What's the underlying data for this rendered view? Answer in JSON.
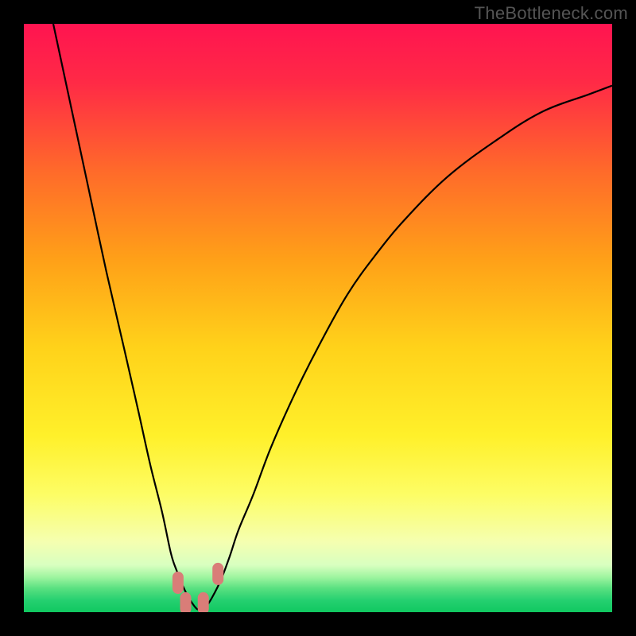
{
  "watermark": "TheBottleneck.com",
  "chart_data": {
    "type": "line",
    "title": "",
    "xlabel": "",
    "ylabel": "",
    "xlim": [
      0,
      1
    ],
    "ylim": [
      0,
      1
    ],
    "grid": false,
    "legend": false,
    "background_gradient_stops": [
      {
        "pos": 0.0,
        "color": "#ff1450"
      },
      {
        "pos": 0.1,
        "color": "#ff2a46"
      },
      {
        "pos": 0.25,
        "color": "#ff6a2a"
      },
      {
        "pos": 0.4,
        "color": "#ffa018"
      },
      {
        "pos": 0.55,
        "color": "#ffd21a"
      },
      {
        "pos": 0.7,
        "color": "#fff02a"
      },
      {
        "pos": 0.8,
        "color": "#fdfd65"
      },
      {
        "pos": 0.88,
        "color": "#f5ffb0"
      },
      {
        "pos": 0.92,
        "color": "#d8ffc0"
      },
      {
        "pos": 0.94,
        "color": "#a0f5a0"
      },
      {
        "pos": 0.96,
        "color": "#58e080"
      },
      {
        "pos": 0.98,
        "color": "#25d070"
      },
      {
        "pos": 1.0,
        "color": "#10c860"
      }
    ],
    "series": [
      {
        "name": "bottleneck-curve",
        "x": [
          0.05,
          0.08,
          0.11,
          0.14,
          0.17,
          0.195,
          0.215,
          0.235,
          0.25,
          0.26,
          0.27,
          0.28,
          0.29,
          0.295,
          0.3,
          0.31,
          0.32,
          0.335,
          0.35,
          0.365,
          0.39,
          0.42,
          0.46,
          0.5,
          0.55,
          0.6,
          0.65,
          0.72,
          0.8,
          0.88,
          0.96,
          1.0
        ],
        "y": [
          1.0,
          0.86,
          0.72,
          0.58,
          0.45,
          0.34,
          0.25,
          0.17,
          0.1,
          0.07,
          0.045,
          0.025,
          0.01,
          0.005,
          0.005,
          0.01,
          0.025,
          0.055,
          0.095,
          0.14,
          0.2,
          0.28,
          0.37,
          0.45,
          0.54,
          0.61,
          0.67,
          0.74,
          0.8,
          0.85,
          0.88,
          0.895
        ]
      }
    ],
    "markers": [
      {
        "name": "left-descent",
        "x": 0.262,
        "y": 0.05,
        "color": "#d97d78"
      },
      {
        "name": "valley-left",
        "x": 0.275,
        "y": 0.015,
        "color": "#d97d78"
      },
      {
        "name": "valley-right",
        "x": 0.305,
        "y": 0.015,
        "color": "#d97d78"
      },
      {
        "name": "right-ascent",
        "x": 0.33,
        "y": 0.065,
        "color": "#d97d78"
      }
    ]
  }
}
